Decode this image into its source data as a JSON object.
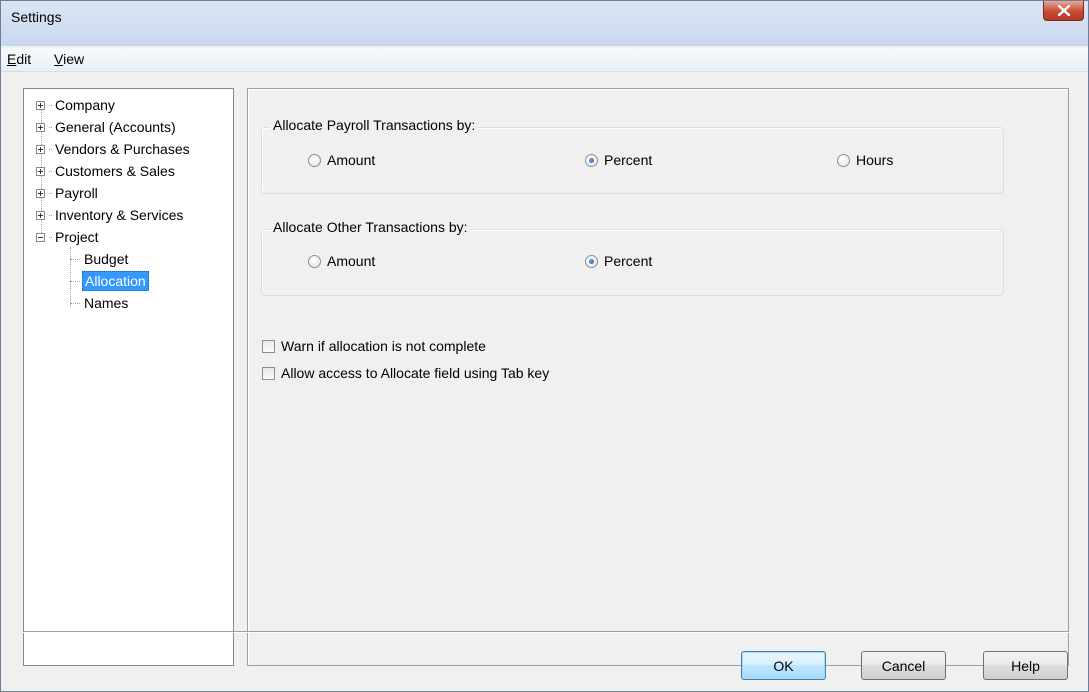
{
  "window": {
    "title": "Settings"
  },
  "menu": {
    "edit": {
      "mnemonic": "E",
      "rest": "dit"
    },
    "view": {
      "mnemonic": "V",
      "rest": "iew"
    }
  },
  "tree": {
    "items": [
      {
        "label": "Company",
        "expander": "plus"
      },
      {
        "label": "General (Accounts)",
        "expander": "plus"
      },
      {
        "label": "Vendors & Purchases",
        "expander": "plus"
      },
      {
        "label": "Customers & Sales",
        "expander": "plus"
      },
      {
        "label": "Payroll",
        "expander": "plus"
      },
      {
        "label": "Inventory & Services",
        "expander": "plus"
      },
      {
        "label": "Project",
        "expander": "minus"
      }
    ],
    "children": [
      {
        "label": "Budget",
        "selected": false
      },
      {
        "label": "Allocation",
        "selected": true
      },
      {
        "label": "Names",
        "selected": false
      }
    ]
  },
  "payroll_group": {
    "label": "Allocate Payroll Transactions by:",
    "options": [
      {
        "label": "Amount",
        "checked": false
      },
      {
        "label": "Percent",
        "checked": true
      },
      {
        "label": "Hours",
        "checked": false
      }
    ]
  },
  "other_group": {
    "label": "Allocate Other Transactions by:",
    "options": [
      {
        "label": "Amount",
        "checked": false
      },
      {
        "label": "Percent",
        "checked": true
      }
    ]
  },
  "checkboxes": [
    {
      "label": "Warn if allocation is not complete",
      "checked": false
    },
    {
      "label": "Allow access to Allocate field using Tab key",
      "checked": false
    }
  ],
  "buttons": {
    "ok": "OK",
    "cancel": "Cancel",
    "help": "Help"
  },
  "colors": {
    "selection": "#3399ff",
    "titlebar": "#c8d8ed",
    "close": "#c74b32"
  },
  "icons": {
    "close": "close-icon",
    "expand": "plus-box-icon",
    "collapse": "minus-box-icon"
  }
}
